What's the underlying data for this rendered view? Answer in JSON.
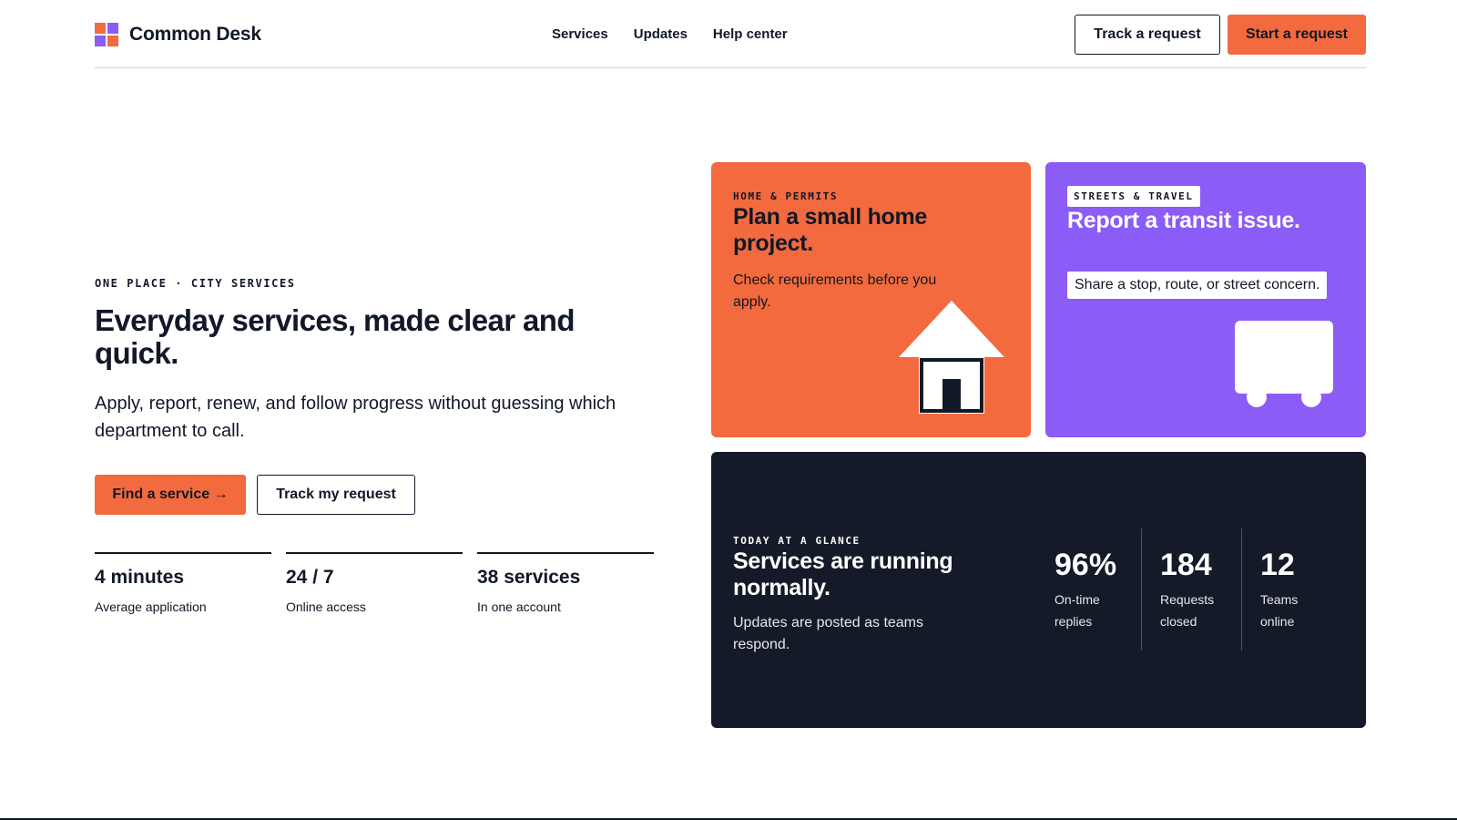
{
  "brand": {
    "name": "Common Desk"
  },
  "nav": {
    "items": [
      "Services",
      "Updates",
      "Help center"
    ]
  },
  "header": {
    "track_label": "Track a request",
    "start_label": "Start a request"
  },
  "hero": {
    "eyebrow": "ONE PLACE · CITY SERVICES",
    "title": "Everyday services, made clear and quick.",
    "subtitle": "Apply, report, renew, and follow progress without guessing which department to call.",
    "primary_cta": "Find a service →",
    "secondary_cta": "Track my request",
    "stats": [
      {
        "value": "4 minutes",
        "label": "Average application"
      },
      {
        "value": "24 / 7",
        "label": "Online access"
      },
      {
        "value": "38 services",
        "label": "In one account"
      }
    ]
  },
  "cards": {
    "home": {
      "tag": "HOME & PERMITS",
      "title": "Plan a small home project.",
      "description": "Check requirements before you apply.",
      "icon": "house-icon"
    },
    "transit": {
      "tag": "STREETS & TRAVEL",
      "title": "Report a transit issue.",
      "description": "Share a stop, route, or street concern.",
      "icon": "bus-icon"
    },
    "glance": {
      "tag": "TODAY AT A GLANCE",
      "title": "Services are running normally.",
      "description": "Updates are posted as teams respond.",
      "metrics": [
        {
          "value": "96%",
          "label": "On-time replies"
        },
        {
          "value": "184",
          "label": "Requests closed"
        },
        {
          "value": "12",
          "label": "Teams online"
        }
      ]
    }
  },
  "colors": {
    "accent_orange": "#f26a3d",
    "accent_purple": "#8b5cf6",
    "dark_panel": "#151a28",
    "ink": "#111827"
  }
}
